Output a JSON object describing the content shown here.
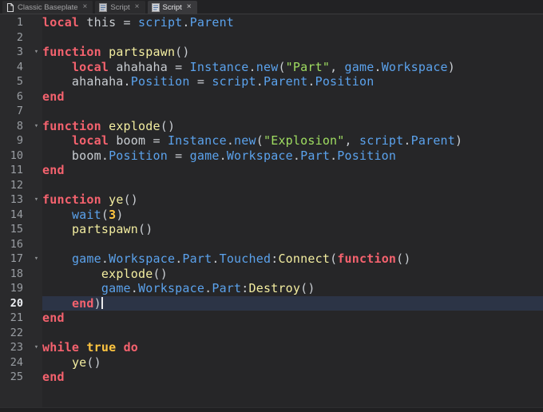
{
  "ui": {
    "close_glyph": "×",
    "fold_glyph": "▾"
  },
  "tabs": [
    {
      "label": "Classic Baseplate",
      "icon": "baseplate-icon",
      "active": false
    },
    {
      "label": "Script",
      "icon": "script-icon",
      "active": false
    },
    {
      "label": "Script",
      "icon": "script-icon",
      "active": true
    }
  ],
  "colors": {
    "editor_bg": "#262628",
    "gutter_bg": "#2a2a2c",
    "current_line_bg": "#2c3446",
    "keyword": "#f4626e",
    "builtin": "#5ba2ec",
    "function": "#f3eda0",
    "string": "#9fdd61",
    "number": "#ffc540",
    "default_text": "#c9cdd2",
    "line_number": "#999da2"
  },
  "editor": {
    "caret_line": 20,
    "lines": [
      {
        "n": 1,
        "fold": false,
        "tokens": [
          [
            "kw",
            "local"
          ],
          [
            "df",
            " this = "
          ],
          [
            "bi",
            "script"
          ],
          [
            "df",
            "."
          ],
          [
            "bi",
            "Parent"
          ]
        ]
      },
      {
        "n": 2,
        "fold": false,
        "tokens": []
      },
      {
        "n": 3,
        "fold": true,
        "tokens": [
          [
            "kw",
            "function"
          ],
          [
            "df",
            " "
          ],
          [
            "fn",
            "partspawn"
          ],
          [
            "df",
            "()"
          ]
        ]
      },
      {
        "n": 4,
        "fold": false,
        "tokens": [
          [
            "df",
            "    "
          ],
          [
            "kw",
            "local"
          ],
          [
            "df",
            " ahahaha = "
          ],
          [
            "bi",
            "Instance"
          ],
          [
            "df",
            "."
          ],
          [
            "bi",
            "new"
          ],
          [
            "df",
            "("
          ],
          [
            "str",
            "\"Part\""
          ],
          [
            "df",
            ", "
          ],
          [
            "bi",
            "game"
          ],
          [
            "df",
            "."
          ],
          [
            "bi",
            "Workspace"
          ],
          [
            "df",
            ")"
          ]
        ]
      },
      {
        "n": 5,
        "fold": false,
        "tokens": [
          [
            "df",
            "    ahahaha."
          ],
          [
            "bi",
            "Position"
          ],
          [
            "df",
            " = "
          ],
          [
            "bi",
            "script"
          ],
          [
            "df",
            "."
          ],
          [
            "bi",
            "Parent"
          ],
          [
            "df",
            "."
          ],
          [
            "bi",
            "Position"
          ]
        ]
      },
      {
        "n": 6,
        "fold": false,
        "tokens": [
          [
            "kw",
            "end"
          ]
        ]
      },
      {
        "n": 7,
        "fold": false,
        "tokens": []
      },
      {
        "n": 8,
        "fold": true,
        "tokens": [
          [
            "kw",
            "function"
          ],
          [
            "df",
            " "
          ],
          [
            "fn",
            "explode"
          ],
          [
            "df",
            "()"
          ]
        ]
      },
      {
        "n": 9,
        "fold": false,
        "tokens": [
          [
            "df",
            "    "
          ],
          [
            "kw",
            "local"
          ],
          [
            "df",
            " boom = "
          ],
          [
            "bi",
            "Instance"
          ],
          [
            "df",
            "."
          ],
          [
            "bi",
            "new"
          ],
          [
            "df",
            "("
          ],
          [
            "str",
            "\"Explosion\""
          ],
          [
            "df",
            ", "
          ],
          [
            "bi",
            "script"
          ],
          [
            "df",
            "."
          ],
          [
            "bi",
            "Parent"
          ],
          [
            "df",
            ")"
          ]
        ]
      },
      {
        "n": 10,
        "fold": false,
        "tokens": [
          [
            "df",
            "    boom."
          ],
          [
            "bi",
            "Position"
          ],
          [
            "df",
            " = "
          ],
          [
            "bi",
            "game"
          ],
          [
            "df",
            "."
          ],
          [
            "bi",
            "Workspace"
          ],
          [
            "df",
            "."
          ],
          [
            "bi",
            "Part"
          ],
          [
            "df",
            "."
          ],
          [
            "bi",
            "Position"
          ]
        ]
      },
      {
        "n": 11,
        "fold": false,
        "tokens": [
          [
            "kw",
            "end"
          ]
        ]
      },
      {
        "n": 12,
        "fold": false,
        "tokens": []
      },
      {
        "n": 13,
        "fold": true,
        "tokens": [
          [
            "kw",
            "function"
          ],
          [
            "df",
            " "
          ],
          [
            "fn",
            "ye"
          ],
          [
            "df",
            "()"
          ]
        ]
      },
      {
        "n": 14,
        "fold": false,
        "tokens": [
          [
            "df",
            "    "
          ],
          [
            "bi",
            "wait"
          ],
          [
            "df",
            "("
          ],
          [
            "num",
            "3"
          ],
          [
            "df",
            ")"
          ]
        ]
      },
      {
        "n": 15,
        "fold": false,
        "tokens": [
          [
            "df",
            "    "
          ],
          [
            "fn",
            "partspawn"
          ],
          [
            "df",
            "()"
          ]
        ]
      },
      {
        "n": 16,
        "fold": false,
        "tokens": []
      },
      {
        "n": 17,
        "fold": true,
        "tokens": [
          [
            "df",
            "    "
          ],
          [
            "bi",
            "game"
          ],
          [
            "df",
            "."
          ],
          [
            "bi",
            "Workspace"
          ],
          [
            "df",
            "."
          ],
          [
            "bi",
            "Part"
          ],
          [
            "df",
            "."
          ],
          [
            "bi",
            "Touched"
          ],
          [
            "df",
            ":"
          ],
          [
            "fn",
            "Connect"
          ],
          [
            "df",
            "("
          ],
          [
            "kw",
            "function"
          ],
          [
            "df",
            "()"
          ]
        ]
      },
      {
        "n": 18,
        "fold": false,
        "tokens": [
          [
            "df",
            "        "
          ],
          [
            "fn",
            "explode"
          ],
          [
            "df",
            "()"
          ]
        ]
      },
      {
        "n": 19,
        "fold": false,
        "tokens": [
          [
            "df",
            "        "
          ],
          [
            "bi",
            "game"
          ],
          [
            "df",
            "."
          ],
          [
            "bi",
            "Workspace"
          ],
          [
            "df",
            "."
          ],
          [
            "bi",
            "Part"
          ],
          [
            "df",
            ":"
          ],
          [
            "fn",
            "Destroy"
          ],
          [
            "df",
            "()"
          ]
        ]
      },
      {
        "n": 20,
        "fold": false,
        "tokens": [
          [
            "df",
            "    "
          ],
          [
            "kw",
            "end"
          ],
          [
            "df",
            ")"
          ]
        ]
      },
      {
        "n": 21,
        "fold": false,
        "tokens": [
          [
            "kw",
            "end"
          ]
        ]
      },
      {
        "n": 22,
        "fold": false,
        "tokens": []
      },
      {
        "n": 23,
        "fold": true,
        "tokens": [
          [
            "kw",
            "while"
          ],
          [
            "df",
            " "
          ],
          [
            "num",
            "true"
          ],
          [
            "df",
            " "
          ],
          [
            "kw",
            "do"
          ]
        ]
      },
      {
        "n": 24,
        "fold": false,
        "tokens": [
          [
            "df",
            "    "
          ],
          [
            "fn",
            "ye"
          ],
          [
            "df",
            "()"
          ]
        ]
      },
      {
        "n": 25,
        "fold": false,
        "tokens": [
          [
            "kw",
            "end"
          ]
        ]
      }
    ]
  }
}
